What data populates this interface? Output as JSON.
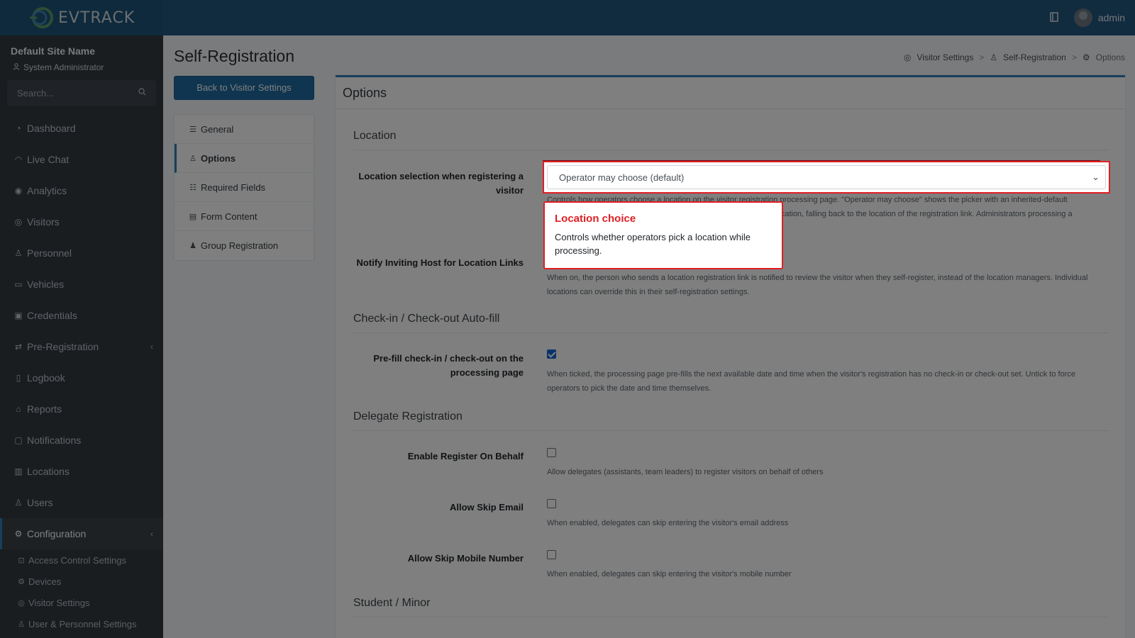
{
  "header": {
    "brand": "EVTRACK",
    "user": "admin",
    "colors": {
      "topbar": "#23577f",
      "sidebar": "#343a40",
      "accent": "#2d7fb8",
      "highlight": "#e01e24"
    }
  },
  "sidebar": {
    "site_name": "Default Site Name",
    "role": "System Administrator",
    "search_placeholder": "Search...",
    "items": [
      {
        "label": "Dashboard",
        "icon": "dashboard-icon"
      },
      {
        "label": "Live Chat",
        "icon": "headset-icon"
      },
      {
        "label": "Analytics",
        "icon": "target-icon"
      },
      {
        "label": "Visitors",
        "icon": "eye-icon"
      },
      {
        "label": "Personnel",
        "icon": "user-gear-icon"
      },
      {
        "label": "Vehicles",
        "icon": "car-icon"
      },
      {
        "label": "Credentials",
        "icon": "id-card-icon"
      },
      {
        "label": "Pre-Registration",
        "icon": "arrows-icon"
      },
      {
        "label": "Logbook",
        "icon": "book-icon"
      },
      {
        "label": "Reports",
        "icon": "chart-icon"
      },
      {
        "label": "Notifications",
        "icon": "bell-icon"
      },
      {
        "label": "Locations",
        "icon": "building-icon"
      },
      {
        "label": "Users",
        "icon": "users-icon"
      },
      {
        "label": "Configuration",
        "icon": "gear-icon"
      }
    ],
    "sub_items": [
      {
        "label": "Access Control Settings",
        "icon": "lock-icon"
      },
      {
        "label": "Devices",
        "icon": "gear-small-icon"
      },
      {
        "label": "Visitor Settings",
        "icon": "eye-icon"
      },
      {
        "label": "User & Personnel Settings",
        "icon": "user-icon"
      }
    ]
  },
  "page": {
    "title": "Self-Registration",
    "breadcrumb": [
      "Visitor Settings",
      "Self-Registration",
      "Options"
    ],
    "back_button": "Back to Visitor Settings",
    "subnav": [
      "General",
      "Options",
      "Required Fields",
      "Form Content",
      "Group Registration"
    ],
    "card_title": "Options"
  },
  "sections": {
    "location": "Location",
    "checkin": "Check-in / Check-out Auto-fill",
    "delegate": "Delegate Registration",
    "student": "Student / Minor"
  },
  "fields": {
    "location_selection": {
      "label": "Location selection when registering a visitor",
      "value": "Operator may choose (default)",
      "help": "Controls how operators choose a location on the visitor registration processing page. \"Operator may choose\" shows the picker with an inherited-default selection. \"Automatic\" hides the picker and assigns the operator's location, falling back to the location of the registration link. Administrators processing a registration always see the full picker regardless of this setting."
    },
    "notify_host": {
      "label": "Notify Inviting Host for Location Links",
      "help": "When on, the person who sends a location registration link is notified to review the visitor when they self-register, instead of the location managers. Individual locations can override this in their self-registration settings."
    },
    "prefill": {
      "label": "Pre-fill check-in / check-out on the processing page",
      "checked": true,
      "help": "When ticked, the processing page pre-fills the next available date and time when the visitor's registration has no check-in or check-out set. Untick to force operators to pick the date and time themselves."
    },
    "register_on_behalf": {
      "label": "Enable Register On Behalf",
      "checked": false,
      "help": "Allow delegates (assistants, team leaders) to register visitors on behalf of others"
    },
    "skip_email": {
      "label": "Allow Skip Email",
      "checked": false,
      "help": "When enabled, delegates can skip entering the visitor's email address"
    },
    "skip_mobile": {
      "label": "Allow Skip Mobile Number",
      "checked": false,
      "help": "When enabled, delegates can skip entering the visitor's mobile number"
    }
  },
  "tooltip": {
    "title": "Location choice",
    "body": "Controls whether operators pick a location while processing."
  }
}
